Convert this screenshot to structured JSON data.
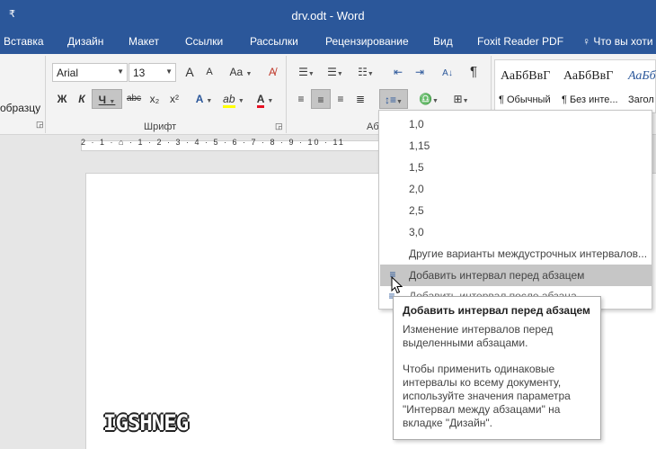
{
  "window": {
    "title": "drv.odt - Word",
    "qat_label": "₹"
  },
  "menubar": {
    "tabs": [
      "Вставка",
      "Дизайн",
      "Макет",
      "Ссылки",
      "Рассылки",
      "Рецензирование",
      "Вид",
      "Foxit Reader PDF"
    ],
    "tell_me": "Что вы хоти"
  },
  "clipboard": {
    "format_painter_label": "образцу"
  },
  "font": {
    "name": "Arial",
    "size": "13",
    "group_label": "Шрифт",
    "buttons": {
      "grow": "A",
      "shrink": "A",
      "case": "Aa",
      "bold": "Ж",
      "italic": "К",
      "underline": "Ч",
      "strike": "abc",
      "sub": "x₂",
      "sup": "x²",
      "effects": "A",
      "highlight": "ab",
      "color": "A"
    }
  },
  "paragraph": {
    "group_label_partial": "Аб",
    "show_marks": "¶"
  },
  "styles": {
    "items": [
      {
        "preview": "АаБбВвГ",
        "label": "¶ Обычный"
      },
      {
        "preview": "АаБбВвГ",
        "label": "¶ Без инте..."
      },
      {
        "preview": "АаБб",
        "label": "Загол"
      }
    ]
  },
  "ruler": {
    "text": "2 · 1 · ⌂ · 1 · 2 · 3 · 4 · 5 · 6 · 7 · 8 · 9 · 10 · 11"
  },
  "line_spacing_menu": {
    "options": [
      "1,0",
      "1,15",
      "1,5",
      "2,0",
      "2,5",
      "3,0"
    ],
    "more": "Другие варианты междустрочных интервалов...",
    "add_before": "Добавить интервал перед абзацем",
    "add_after_partial": "Добавить интервал после абзаца"
  },
  "tooltip": {
    "title": "Добавить интервал перед абзацем",
    "line1": "Изменение интервалов перед\nвыделенными абзацами.",
    "line2": "Чтобы применить одинаковые\nинтервалы ко всему документу,\nиспользуйте значения параметра\n\"Интервал между абзацами\" на\nвкладке \"Дизайн\"."
  },
  "watermark": {
    "text": "IGSHNEG"
  },
  "colors": {
    "accent": "#2b579a",
    "highlight_menu": "#c6c6c6",
    "font_color": "#e81123",
    "highlight_color": "#ffff00"
  }
}
